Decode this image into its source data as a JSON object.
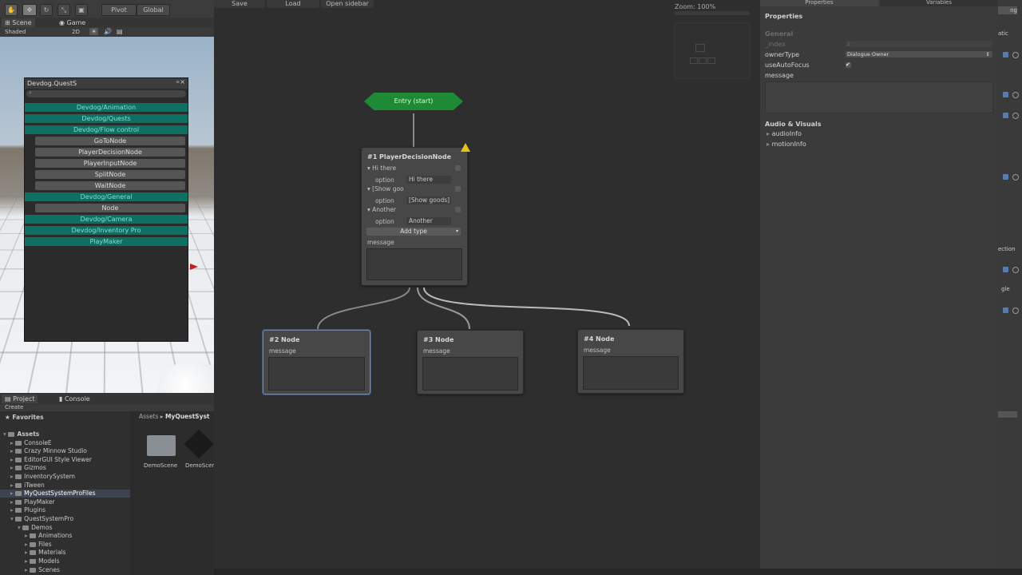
{
  "toolbar": {
    "pivot_label": "Pivot",
    "global_label": "Global"
  },
  "scene": {
    "tab_scene": "Scene",
    "tab_game": "Game",
    "shading": "Shaded",
    "mode_2d": "2D"
  },
  "quest_window": {
    "title": "Devdog.QuestS",
    "rows": [
      {
        "label": "Devdog/Animation",
        "kind": "cat"
      },
      {
        "label": "Devdog/Quests",
        "kind": "cat"
      },
      {
        "label": "Devdog/Flow control",
        "kind": "cat"
      },
      {
        "label": "GoToNode",
        "kind": "item"
      },
      {
        "label": "PlayerDecisionNode",
        "kind": "item"
      },
      {
        "label": "PlayerInputNode",
        "kind": "item"
      },
      {
        "label": "SplitNode",
        "kind": "item"
      },
      {
        "label": "WaitNode",
        "kind": "item"
      },
      {
        "label": "Devdog/General",
        "kind": "cat"
      },
      {
        "label": "Node",
        "kind": "item"
      },
      {
        "label": "Devdog/Camera",
        "kind": "cat"
      },
      {
        "label": "Devdog/Inventory Pro",
        "kind": "cat"
      },
      {
        "label": "PlayMaker",
        "kind": "cat"
      }
    ]
  },
  "project": {
    "tab_project": "Project",
    "tab_console": "Console",
    "create_label": "Create",
    "breadcrumb_root": "Assets",
    "breadcrumb_current": "MyQuestSyst",
    "favorites_label": "Favorites",
    "tree": [
      {
        "label": "Assets",
        "depth": 0,
        "bold": true
      },
      {
        "label": "ConsoleE",
        "depth": 1
      },
      {
        "label": "Crazy Minnow Studio",
        "depth": 1
      },
      {
        "label": "EditorGUI Style Viewer",
        "depth": 1
      },
      {
        "label": "Gizmos",
        "depth": 1
      },
      {
        "label": "InventorySystem",
        "depth": 1
      },
      {
        "label": "iTween",
        "depth": 1
      },
      {
        "label": "MyQuestSystemProFiles",
        "depth": 1,
        "selected": true
      },
      {
        "label": "PlayMaker",
        "depth": 1
      },
      {
        "label": "Plugins",
        "depth": 1
      },
      {
        "label": "QuestSystemPro",
        "depth": 1
      },
      {
        "label": "Demos",
        "depth": 2
      },
      {
        "label": "Animations",
        "depth": 3
      },
      {
        "label": "Files",
        "depth": 3
      },
      {
        "label": "Materials",
        "depth": 3
      },
      {
        "label": "Models",
        "depth": 3
      },
      {
        "label": "Scenes",
        "depth": 3
      }
    ],
    "assets": [
      {
        "label": "DemoScene",
        "icon": "folder-icon"
      },
      {
        "label": "DemoScen",
        "icon": "unity-icon"
      }
    ]
  },
  "editor": {
    "save_label": "Save",
    "load_label": "Load",
    "sidebar_label": "Open sidebar",
    "zoom_label": "Zoom: 100%",
    "entry_label": "Entry (start)",
    "decision_node": {
      "title": "#1 PlayerDecisionNode",
      "options": [
        {
          "header": "Hi there",
          "option_label": "option",
          "value": "Hi there"
        },
        {
          "header": "[Show goo",
          "option_label": "option",
          "value": "[Show goods]"
        },
        {
          "header": "Another",
          "option_label": "option",
          "value": "Another"
        }
      ],
      "add_type_label": "Add type",
      "message_label": "message"
    },
    "nodes": [
      {
        "title": "#2 Node",
        "message_label": "message"
      },
      {
        "title": "#3 Node",
        "message_label": "message"
      },
      {
        "title": "#4 Node",
        "message_label": "message"
      }
    ]
  },
  "properties": {
    "tab_properties": "Properties",
    "tab_variables": "Variables",
    "heading": "Properties",
    "general_label": "General",
    "index_label": "_index",
    "index_value": "2",
    "owner_type_label": "ownerType",
    "owner_type_value": "Dialogue Owner",
    "use_auto_focus_label": "useAutoFocus",
    "use_auto_focus_checked": true,
    "message_label": "message",
    "audio_visuals_label": "Audio & Visuals",
    "audio_info_label": "audioInfo",
    "motion_info_label": "motionInfo"
  },
  "inspector_edge": {
    "top_label": "ng",
    "label_atic": "atic",
    "label_ection": "ection",
    "label_gle": "gle"
  }
}
